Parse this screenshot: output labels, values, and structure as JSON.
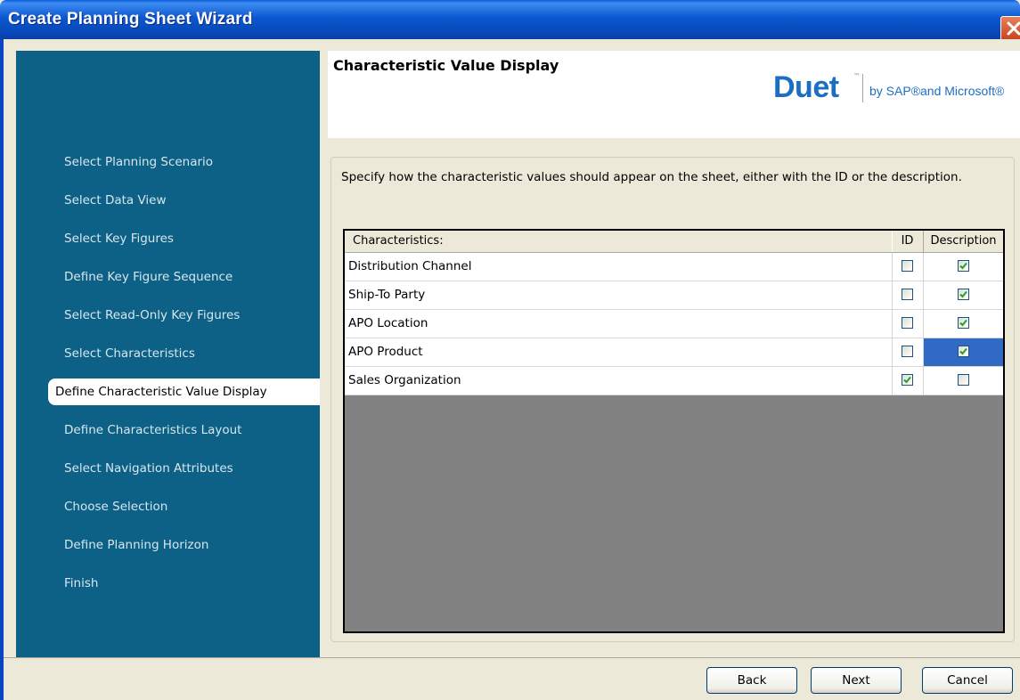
{
  "window": {
    "title": "Create Planning Sheet Wizard"
  },
  "sidebar": {
    "items": [
      {
        "label": "Select Planning Scenario",
        "active": false
      },
      {
        "label": "Select Data View",
        "active": false
      },
      {
        "label": "Select Key Figures",
        "active": false
      },
      {
        "label": "Define Key Figure Sequence",
        "active": false
      },
      {
        "label": "Select Read-Only Key Figures",
        "active": false
      },
      {
        "label": "Select Characteristics",
        "active": false
      },
      {
        "label": "Define Characteristic Value Display",
        "active": true
      },
      {
        "label": "Define Characteristics Layout",
        "active": false
      },
      {
        "label": "Select Navigation Attributes",
        "active": false
      },
      {
        "label": "Choose Selection",
        "active": false
      },
      {
        "label": "Define Planning Horizon",
        "active": false
      },
      {
        "label": "Finish",
        "active": false
      }
    ]
  },
  "header": {
    "title": "Characteristic Value Display",
    "logo_text": "Duet",
    "logo_tm": "™",
    "logo_by": "by SAP®and Microsoft®"
  },
  "content": {
    "instruction": "Specify how the characteristic values should appear on the sheet, either with the ID or the description."
  },
  "grid": {
    "columns": {
      "characteristics": "Characteristics:",
      "id": "ID",
      "description": "Description"
    },
    "rows": [
      {
        "label": "Distribution Channel",
        "id": false,
        "description": true,
        "selected": false
      },
      {
        "label": "Ship-To Party",
        "id": false,
        "description": true,
        "selected": false
      },
      {
        "label": "APO Location",
        "id": false,
        "description": true,
        "selected": false
      },
      {
        "label": "APO Product",
        "id": false,
        "description": true,
        "selected": true
      },
      {
        "label": "Sales Organization",
        "id": true,
        "description": false,
        "selected": false
      }
    ]
  },
  "buttons": {
    "back": "Back",
    "next": "Next",
    "cancel": "Cancel"
  },
  "colors": {
    "sidebar_bg": "#0d6186",
    "titlebar": "#0b57d0",
    "selection": "#316ac5",
    "check": "#21a121",
    "logo": "#1b6ec2"
  }
}
